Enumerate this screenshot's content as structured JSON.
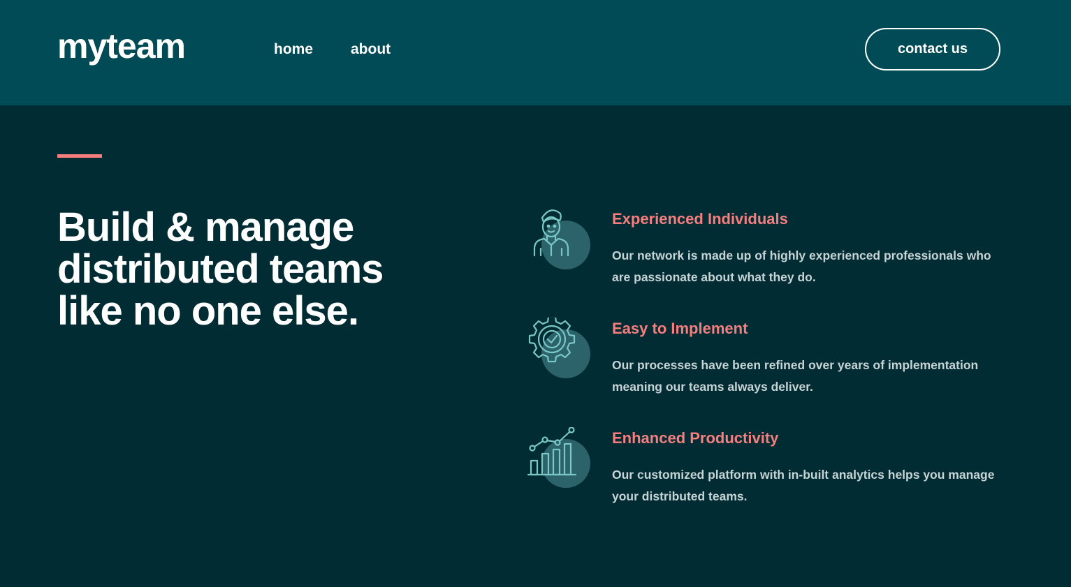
{
  "header": {
    "logo": "myteam",
    "nav": [
      {
        "label": "home"
      },
      {
        "label": "about"
      }
    ],
    "contact_label": "contact us"
  },
  "hero": {
    "title_line1": "Build & manage",
    "title_line2": "distributed teams",
    "title_line3": "like no one else."
  },
  "features": [
    {
      "icon": "person-icon",
      "title": "Experienced Individuals",
      "description": "Our network is made up of highly experienced professionals who are passionate about what they do."
    },
    {
      "icon": "gear-check-icon",
      "title": "Easy to Implement",
      "description": "Our processes have been refined over years of implementation meaning our teams always deliver."
    },
    {
      "icon": "bar-chart-icon",
      "title": "Enhanced Productivity",
      "description": "Our customized platform with in-built analytics helps you manage your distributed teams."
    }
  ],
  "colors": {
    "header_bg": "#004b55",
    "body_bg": "#022c33",
    "accent": "#f67e7e",
    "icon_stroke": "#79c8c7",
    "icon_circle": "#2c6269",
    "text_light": "#ffffff",
    "text_muted": "#c7d4d6"
  }
}
